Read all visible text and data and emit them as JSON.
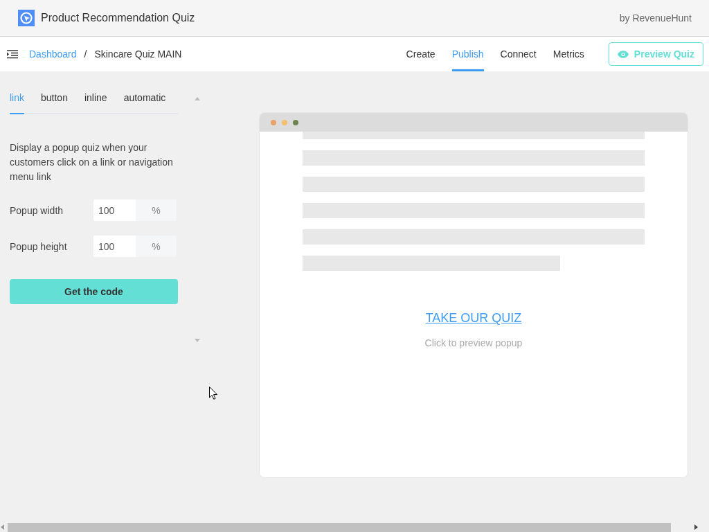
{
  "header": {
    "title": "Product Recommendation Quiz",
    "byline": "by RevenueHunt"
  },
  "breadcrumb": [
    {
      "label": "Dashboard",
      "kind": "link"
    },
    {
      "label": "/",
      "kind": "separator"
    },
    {
      "label": "Skincare Quiz MAIN",
      "kind": "current"
    }
  ],
  "nav_tabs": [
    {
      "label": "Create",
      "selected": false
    },
    {
      "label": "Publish",
      "selected": true
    },
    {
      "label": "Connect",
      "selected": false
    },
    {
      "label": "Metrics",
      "selected": false
    }
  ],
  "preview_button": {
    "label": "Preview Quiz"
  },
  "mode_tabs": [
    {
      "label": "link",
      "selected": true
    },
    {
      "label": "button",
      "selected": false
    },
    {
      "label": "inline",
      "selected": false
    },
    {
      "label": "automatic",
      "selected": false
    }
  ],
  "description": "Display a popup quiz when your customers click on a link or navigation menu link",
  "fields": [
    {
      "label": "Popup width",
      "value": "100",
      "unit": "%"
    },
    {
      "label": "Popup height",
      "value": "100",
      "unit": "%"
    }
  ],
  "code_button": {
    "label": "Get the code"
  },
  "preview": {
    "link": "TAKE OUR QUIZ",
    "hint": "Click to preview popup"
  }
}
